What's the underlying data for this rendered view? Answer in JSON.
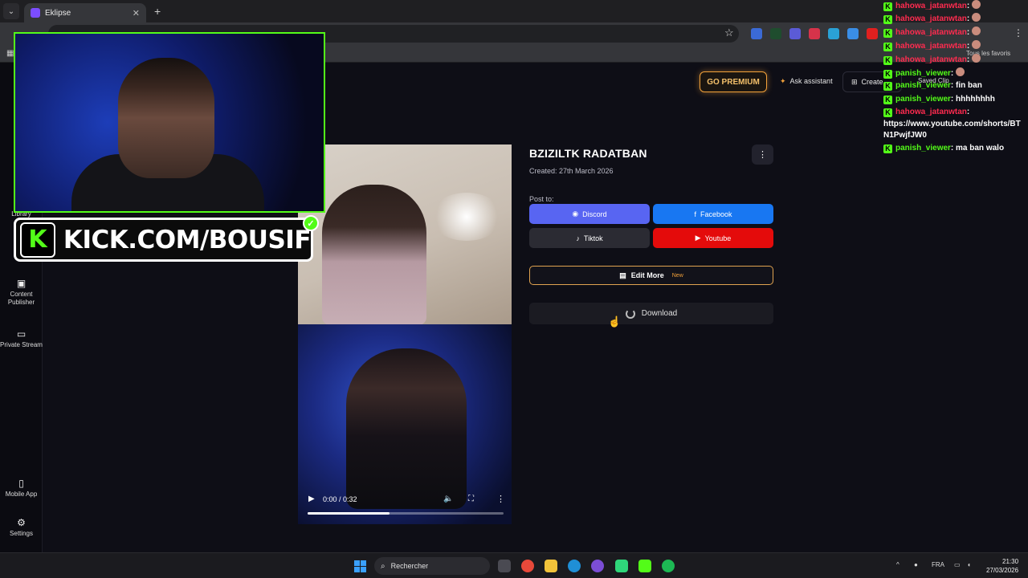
{
  "browser": {
    "tab_title": "Eklipse",
    "tab_close": "✕",
    "new_tab": "+",
    "bookmark_all": "Tous les favoris"
  },
  "app": {
    "go_premium": "GO PREMIUM",
    "ask_assistant": "Ask assistant",
    "create": "Create",
    "sidebar": {
      "library": "Library",
      "content_publisher": "Content Publisher",
      "private_stream": "Private Stream",
      "mobile_app": "Mobile App",
      "settings": "Settings"
    }
  },
  "clip": {
    "title": "BZIZILTK RADATBAN",
    "created": "Created: 27th March 2026",
    "post_to": "Post to:",
    "buttons": {
      "discord": "Discord",
      "facebook": "Facebook",
      "tiktok": "Tiktok",
      "youtube": "Youtube"
    },
    "edit_more": "Edit More",
    "edit_badge": "New",
    "download": "Download",
    "player": {
      "time": "0:00 / 0:32",
      "buffered": 0.42
    }
  },
  "overlay": {
    "kick_url": "KICK.COM/BOUSIF",
    "kick_letter": "K"
  },
  "chat": {
    "messages": [
      {
        "user": "hahowa_jatanwtan",
        "text": ""
      },
      {
        "user": "hahowa_jatanwtan",
        "text": ""
      },
      {
        "user": "hahowa_jatanwtan",
        "text": ""
      },
      {
        "user": "hahowa_jatanwtan",
        "text": ""
      },
      {
        "user": "hahowa_jatanwtan",
        "text": ""
      },
      {
        "user": "panish_viewer",
        "text": ""
      },
      {
        "user": "panish_viewer",
        "text": "fin ban"
      },
      {
        "user": "panish_viewer",
        "text": "hhhhhhhh"
      },
      {
        "user": "hahowa_jatanwtan",
        "text": ""
      },
      {
        "user": "panish_viewer",
        "text": "ma ban walo"
      }
    ],
    "link": "https://www.youtube.com/shorts/BTN1PwjfJW0",
    "saved_clip": "Saved Clip"
  },
  "taskbar": {
    "search": "Rechercher",
    "lang": "FRA",
    "time": "21:30",
    "date": "27/03/2026"
  },
  "colors": {
    "discord": "#5865f2",
    "facebook": "#1877f2",
    "tiktok": "#2b2b33",
    "youtube": "#e40b0b",
    "kick_green": "#53fc18",
    "premium": "#f2a13a"
  }
}
